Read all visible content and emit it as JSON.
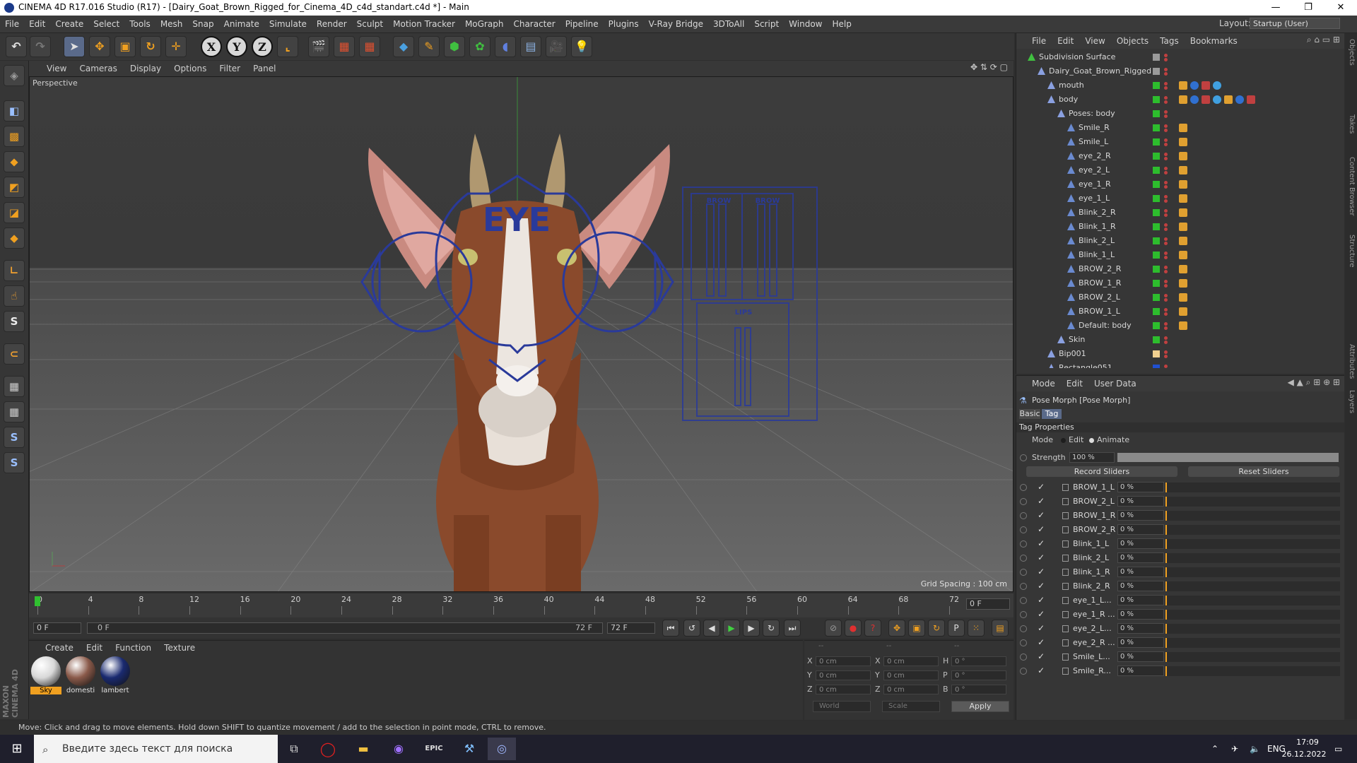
{
  "window": {
    "title": "CINEMA 4D R17.016 Studio (R17) - [Dairy_Goat_Brown_Rigged_for_Cinema_4D_c4d_standart.c4d *] - Main",
    "controls": [
      "—",
      "❐",
      "✕"
    ]
  },
  "menubar": {
    "items": [
      "File",
      "Edit",
      "Create",
      "Select",
      "Tools",
      "Mesh",
      "Snap",
      "Animate",
      "Simulate",
      "Render",
      "Sculpt",
      "Motion Tracker",
      "MoGraph",
      "Character",
      "Pipeline",
      "Plugins",
      "V-Ray Bridge",
      "3DToAll",
      "Script",
      "Window",
      "Help"
    ],
    "layout_label": "Layout:",
    "layout_value": "Startup (User)"
  },
  "viewport": {
    "menu": [
      "View",
      "Cameras",
      "Display",
      "Options",
      "Filter",
      "Panel"
    ],
    "label": "Perspective",
    "grid_spacing": "Grid Spacing : 100 cm",
    "eye_label": "EYE",
    "brow_label1": "BROW",
    "brow_label2": "BROW",
    "lips_label": "LIPS"
  },
  "timeline": {
    "ticks": [
      "0",
      "4",
      "8",
      "12",
      "16",
      "20",
      "24",
      "28",
      "32",
      "36",
      "40",
      "44",
      "48",
      "52",
      "56",
      "60",
      "64",
      "68",
      "72"
    ],
    "current_frame": "0 F",
    "start_frame": "0 F",
    "range_start": "0 F",
    "range_end": "72 F",
    "end_frame": "72 F"
  },
  "materials": {
    "menu": [
      "Create",
      "Edit",
      "Function",
      "Texture"
    ],
    "items": [
      {
        "name": "Sky",
        "color": "#d8d8d8"
      },
      {
        "name": "domesti",
        "color": "#8a5a4a"
      },
      {
        "name": "lambert",
        "color": "#1a2a70"
      }
    ]
  },
  "coords": {
    "headers": [
      "--",
      "--",
      "--"
    ],
    "rows": [
      {
        "a": "X",
        "av": "0 cm",
        "b": "X",
        "bv": "0 cm",
        "c": "H",
        "cv": "0 °"
      },
      {
        "a": "Y",
        "av": "0 cm",
        "b": "Y",
        "bv": "0 cm",
        "c": "P",
        "cv": "0 °"
      },
      {
        "a": "Z",
        "av": "0 cm",
        "b": "Z",
        "bv": "0 cm",
        "c": "B",
        "cv": "0 °"
      }
    ],
    "world": "World",
    "scale": "Scale",
    "apply": "Apply"
  },
  "status": "Move: Click and drag to move elements. Hold down SHIFT to quantize movement / add to the selection in point mode, CTRL to remove.",
  "maxon": "MAXON CINEMA 4D",
  "objects": {
    "menu": [
      "File",
      "Edit",
      "View",
      "Objects",
      "Tags",
      "Bookmarks"
    ],
    "rows": [
      {
        "name": "Subdivision Surface",
        "indent": 0
      },
      {
        "name": "Dairy_Goat_Brown_Rigged",
        "indent": 1
      },
      {
        "name": "mouth",
        "indent": 2
      },
      {
        "name": "body",
        "indent": 2
      },
      {
        "name": "Poses: body",
        "indent": 3
      },
      {
        "name": "Smile_R",
        "indent": 4
      },
      {
        "name": "Smile_L",
        "indent": 4
      },
      {
        "name": "eye_2_R",
        "indent": 4
      },
      {
        "name": "eye_2_L",
        "indent": 4
      },
      {
        "name": "eye_1_R",
        "indent": 4
      },
      {
        "name": "eye_1_L",
        "indent": 4
      },
      {
        "name": "Blink_2_R",
        "indent": 4
      },
      {
        "name": "Blink_1_R",
        "indent": 4
      },
      {
        "name": "Blink_2_L",
        "indent": 4
      },
      {
        "name": "Blink_1_L",
        "indent": 4
      },
      {
        "name": "BROW_2_R",
        "indent": 4
      },
      {
        "name": "BROW_1_R",
        "indent": 4
      },
      {
        "name": "BROW_2_L",
        "indent": 4
      },
      {
        "name": "BROW_1_L",
        "indent": 4
      },
      {
        "name": "Default: body",
        "indent": 4
      },
      {
        "name": "Skin",
        "indent": 3
      },
      {
        "name": "Bip001",
        "indent": 2
      },
      {
        "name": "Rectangle051",
        "indent": 2
      }
    ]
  },
  "attributes": {
    "menu": [
      "Mode",
      "Edit",
      "User Data"
    ],
    "title": "Pose Morph [Pose Morph]",
    "tabs": [
      "Basic",
      "Tag"
    ],
    "section": "Tag Properties",
    "mode_label": "Mode",
    "mode_edit": "Edit",
    "mode_animate": "Animate",
    "strength_label": "Strength",
    "strength_value": "100 %",
    "strength_level": 1.0,
    "record": "Record Sliders",
    "reset": "Reset Sliders",
    "sliders": [
      {
        "name": "BROW_1_L",
        "value": "0 %"
      },
      {
        "name": "BROW_2_L",
        "value": "0 %"
      },
      {
        "name": "BROW_1_R",
        "value": "0 %"
      },
      {
        "name": "BROW_2_R",
        "value": "0 %"
      },
      {
        "name": "Blink_1_L",
        "value": "0 %"
      },
      {
        "name": "Blink_2_L",
        "value": "0 %"
      },
      {
        "name": "Blink_1_R",
        "value": "0 %"
      },
      {
        "name": "Blink_2_R",
        "value": "0 %"
      },
      {
        "name": "eye_1_L...",
        "value": "0 %"
      },
      {
        "name": "eye_1_R ...",
        "value": "0 %"
      },
      {
        "name": "eye_2_L...",
        "value": "0 %"
      },
      {
        "name": "eye_2_R ...",
        "value": "0 %"
      },
      {
        "name": "Smile_L...",
        "value": "0 %"
      },
      {
        "name": "Smile_R...",
        "value": "0 %"
      }
    ]
  },
  "side_tabs": [
    "Objects",
    "Takes",
    "Content Browser",
    "Structure",
    "Attributes",
    "Layers"
  ],
  "taskbar": {
    "search_placeholder": "Введите здесь текст для поиска",
    "lang": "ENG",
    "time": "17:09",
    "date": "26.12.2022",
    "epic": "EPIC"
  },
  "colors": {
    "accent": "#f0a020",
    "visible_green": "#2dbd2d",
    "rig_blue": "#2a3a9a"
  }
}
